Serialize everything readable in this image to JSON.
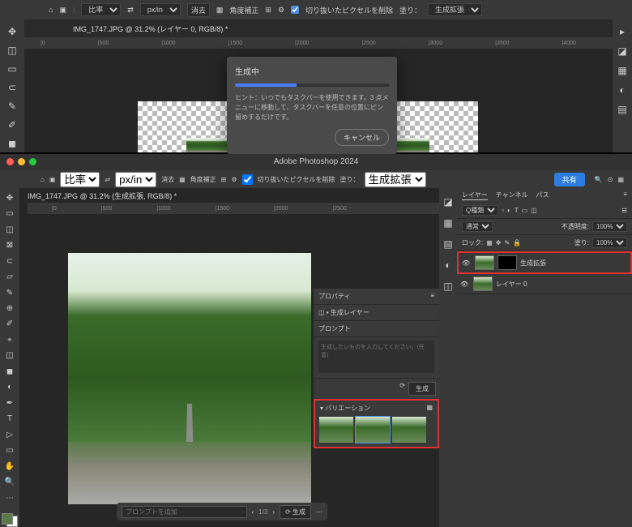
{
  "section1": {
    "topbar": {
      "ratio_label": "比率",
      "unit": "px/in",
      "clear": "消去",
      "angle": "角度補正",
      "remove_px": "切り抜いたピクセルを削除",
      "fill_label": "塗り：",
      "fill_value": "生成拡張"
    },
    "tab": "IMG_1747.JPG @ 31.2% (レイヤー 0, RGB/8) *",
    "ruler": [
      "0",
      "500",
      "1000",
      "1500",
      "2000",
      "2500",
      "3000",
      "3500",
      "4000"
    ],
    "dialog": {
      "title": "生成中",
      "hint": "ヒント：いつでもタスクバーを使用できます。3 点メニューに移動して、タスクバーを任意の位置にピン留めするだけです。",
      "cancel": "キャンセル"
    }
  },
  "section2": {
    "title": "Adobe Photoshop 2024",
    "topbar": {
      "ratio_label": "比率",
      "unit": "px/in",
      "clear": "消去",
      "angle": "角度補正",
      "remove_px": "切り抜いたピクセルを削除",
      "fill_label": "塗り：",
      "fill_value": "生成拡張",
      "share": "共有"
    },
    "tab": "IMG_1747.JPG @ 31.2% (生成拡張, RGB/8) *",
    "ruler": [
      "0",
      "500",
      "1000",
      "1500",
      "2000",
      "2500"
    ],
    "properties": {
      "title": "プロパティ",
      "layer_type": "生成レイヤー",
      "prompt_label": "プロンプト",
      "prompt_placeholder": "生成したいものを入力してください。(任意)",
      "generate": "生成",
      "variations": "バリエーション"
    },
    "taskbar": {
      "placeholder": "プロンプトを追加",
      "page": "1/3",
      "generate": "生成"
    },
    "layers": {
      "tabs": [
        "レイヤー",
        "チャンネル",
        "パス"
      ],
      "kind": "Q種類",
      "blend": "通常",
      "opacity_label": "不透明度:",
      "opacity": "100%",
      "lock_label": "ロック:",
      "fill_label": "塗り:",
      "fill": "100%",
      "items": [
        {
          "name": "生成拡張",
          "has_mask": true,
          "highlight": true
        },
        {
          "name": "レイヤー 0",
          "has_mask": false,
          "highlight": false
        }
      ]
    }
  },
  "tools": [
    "↖",
    "▭",
    "◫",
    "✂",
    "✎",
    "⌖",
    "↘",
    "◐",
    "T",
    "▷",
    "◻",
    "✋",
    "🔍"
  ],
  "tools2": [
    "↖",
    "▭",
    "◫",
    "◐",
    "✂",
    "▱",
    "✎",
    "⊕",
    "≡",
    "⌖",
    "↘",
    "◐",
    "✎",
    "T",
    "▷",
    "◻",
    "✋",
    "🔍",
    "⋯"
  ]
}
